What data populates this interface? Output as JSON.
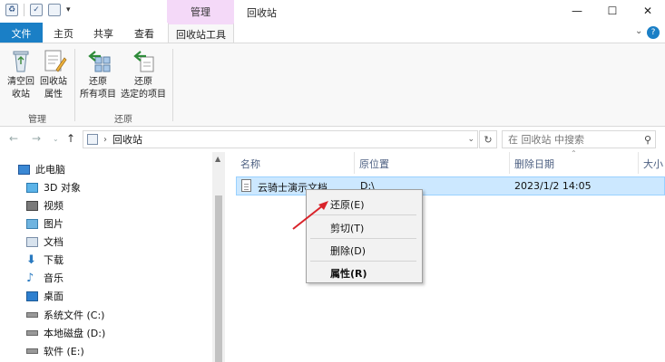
{
  "window": {
    "manage_tab": "管理",
    "title": "回收站",
    "controls": [
      "—",
      "☐",
      "✕"
    ]
  },
  "ribbon_tabs": {
    "file": "文件",
    "home": "主页",
    "share": "共享",
    "view": "查看",
    "tools": "回收站工具"
  },
  "ribbon": {
    "empty_line1": "清空回",
    "empty_line2": "收站",
    "props_line1": "回收站",
    "props_line2": "属性",
    "group_manage": "管理",
    "restore_all_line1": "还原",
    "restore_all_line2": "所有项目",
    "restore_sel_line1": "还原",
    "restore_sel_line2": "选定的项目",
    "group_restore": "还原"
  },
  "address": {
    "path": "回收站",
    "search_placeholder": "在 回收站 中搜索"
  },
  "nav_items": [
    {
      "label": "此电脑",
      "icon": "pc-icon"
    },
    {
      "label": "3D 对象",
      "icon": "3d-objects-icon"
    },
    {
      "label": "视频",
      "icon": "video-icon"
    },
    {
      "label": "图片",
      "icon": "pictures-icon"
    },
    {
      "label": "文档",
      "icon": "documents-icon"
    },
    {
      "label": "下载",
      "icon": "download-icon"
    },
    {
      "label": "音乐",
      "icon": "music-icon"
    },
    {
      "label": "桌面",
      "icon": "desktop-icon"
    },
    {
      "label": "系统文件 (C:)",
      "icon": "drive-icon"
    },
    {
      "label": "本地磁盘 (D:)",
      "icon": "drive-icon"
    },
    {
      "label": "软件 (E:)",
      "icon": "drive-icon"
    }
  ],
  "columns": [
    "名称",
    "原位置",
    "删除日期",
    "大小"
  ],
  "file": {
    "name": "云骑士演示文档",
    "location": "D:\\",
    "deleted": "2023/1/2 14:05"
  },
  "context_menu": {
    "restore": "还原(E)",
    "cut": "剪切(T)",
    "delete": "删除(D)",
    "properties": "属性(R)"
  },
  "colors": {
    "accent": "#1a7fc6",
    "manage_tab": "#f4d9f8",
    "selection": "#cce8ff",
    "annotation_arrow": "#d9232a"
  }
}
